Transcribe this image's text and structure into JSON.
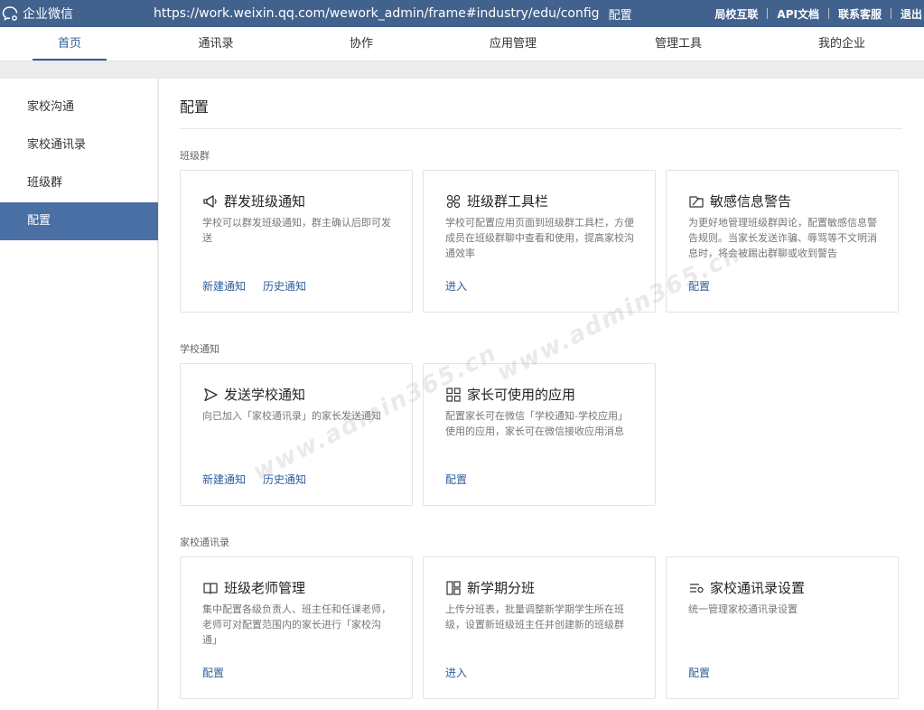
{
  "topbar": {
    "brand": "企业微信",
    "url": "https://work.weixin.qq.com/wework_admin/frame#industry/edu/config",
    "url_suffix": "配置",
    "links": [
      "局校互联",
      "API文档",
      "联系客服",
      "退出"
    ]
  },
  "nav": {
    "items": [
      "首页",
      "通讯录",
      "协作",
      "应用管理",
      "管理工具",
      "我的企业"
    ],
    "active": "首页"
  },
  "sidebar": {
    "items": [
      "家校沟通",
      "家校通讯录",
      "班级群",
      "配置"
    ],
    "active": "配置"
  },
  "main": {
    "title": "配置",
    "sections": [
      {
        "label": "班级群",
        "cards": [
          {
            "icon": "megaphone-icon",
            "title": "群发班级通知",
            "desc": "学校可以群发班级通知，群主确认后即可发送",
            "actions": [
              "新建通知",
              "历史通知"
            ]
          },
          {
            "icon": "toolbar-icon",
            "title": "班级群工具栏",
            "desc": "学校可配置应用页面到班级群工具栏，方便成员在班级群聊中查看和使用，提高家校沟通效率",
            "actions": [
              "进入"
            ]
          },
          {
            "icon": "warning-flag-icon",
            "title": "敏感信息警告",
            "desc": "为更好地管理班级群舆论，配置敏感信息警告规则。当家长发送诈骗、辱骂等不文明消息时，将会被踢出群聊或收到警告",
            "actions": [
              "配置"
            ]
          }
        ]
      },
      {
        "label": "学校通知",
        "cards": [
          {
            "icon": "send-icon",
            "title": "发送学校通知",
            "desc": "向已加入「家校通讯录」的家长发送通知",
            "actions": [
              "新建通知",
              "历史通知"
            ]
          },
          {
            "icon": "apps-grid-icon",
            "title": "家长可使用的应用",
            "desc": "配置家长可在微信「学校通知-学校应用」使用的应用，家长可在微信接收应用消息",
            "actions": [
              "配置"
            ]
          }
        ]
      },
      {
        "label": "家校通讯录",
        "cards": [
          {
            "icon": "book-icon",
            "title": "班级老师管理",
            "desc": "集中配置各级负责人、班主任和任课老师，老师可对配置范围内的家长进行「家校沟通」",
            "actions": [
              "配置"
            ]
          },
          {
            "icon": "class-split-icon",
            "title": "新学期分班",
            "desc": "上传分班表，批量调整新学期学生所在班级，设置新班级班主任并创建新的班级群",
            "actions": [
              "进入"
            ]
          },
          {
            "icon": "list-settings-icon",
            "title": "家校通讯录设置",
            "desc": "统一管理家校通讯录设置",
            "actions": [
              "配置"
            ]
          }
        ]
      }
    ]
  },
  "watermark": "www.admin365.cn",
  "colors": {
    "topbar_bg": "#42628e",
    "accent": "#2f5e9c",
    "sidebar_active_bg": "#4a6fa5"
  }
}
